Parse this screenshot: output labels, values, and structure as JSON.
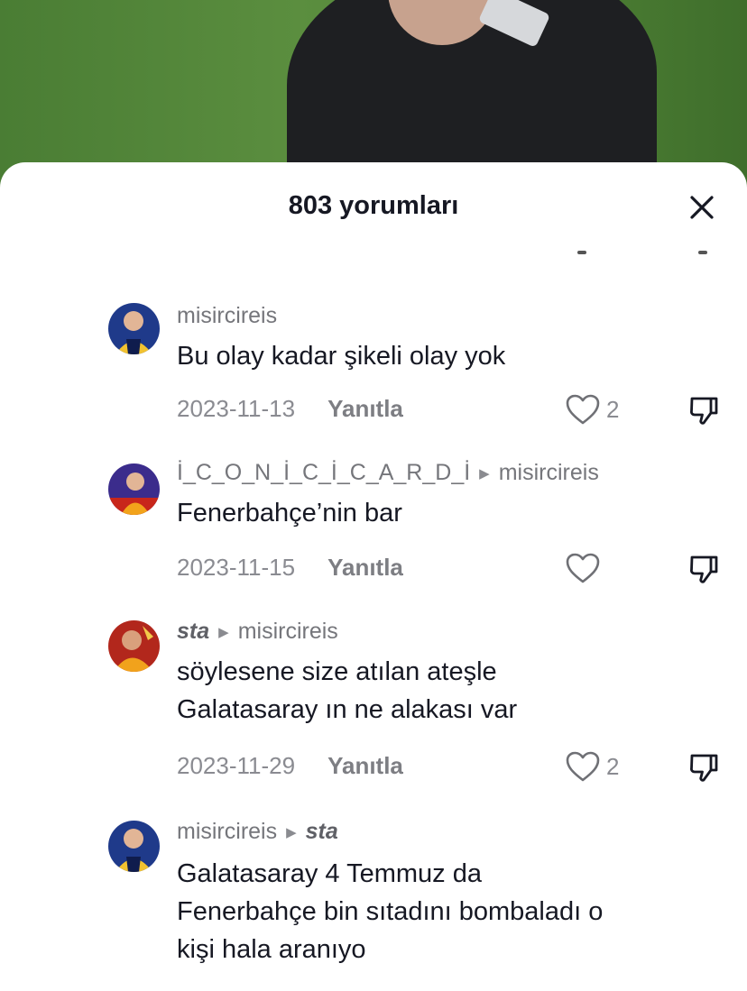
{
  "header": {
    "title": "803 yorumları"
  },
  "comments": [
    {
      "username": "misircireis",
      "reply_to": "",
      "text": [
        "Bu olay kadar şikeli olay yok"
      ],
      "date": "2023-11-13",
      "reply_label": "Yanıtla",
      "likes": "2",
      "avatar_color": "#1f3a8a"
    },
    {
      "username": "İ_C_O_N_İ_C_İ_C_A_R_D_İ",
      "reply_to": "misircireis",
      "text": [
        "Fenerbahçe’nin bar"
      ],
      "date": "2023-11-15",
      "reply_label": "Yanıtla",
      "likes": "",
      "avatar_color": "#3b2c8c"
    },
    {
      "username": "sta",
      "reply_to": "misircireis",
      "text": [
        "söylesene size atılan ateşle",
        "Galatasaray ın ne alakası var"
      ],
      "date": "2023-11-29",
      "reply_label": "Yanıtla",
      "likes": "2",
      "avatar_color": "#b2271c"
    },
    {
      "username": "misircireis",
      "reply_to": "sta",
      "text": [
        "Galatasaray 4 Temmuz da",
        "Fenerbahçe bin sıtadını bombaladı o",
        "kişi hala aranıyo"
      ],
      "date": "",
      "reply_label": "",
      "likes": "",
      "avatar_color": "#1f3a8a"
    }
  ]
}
